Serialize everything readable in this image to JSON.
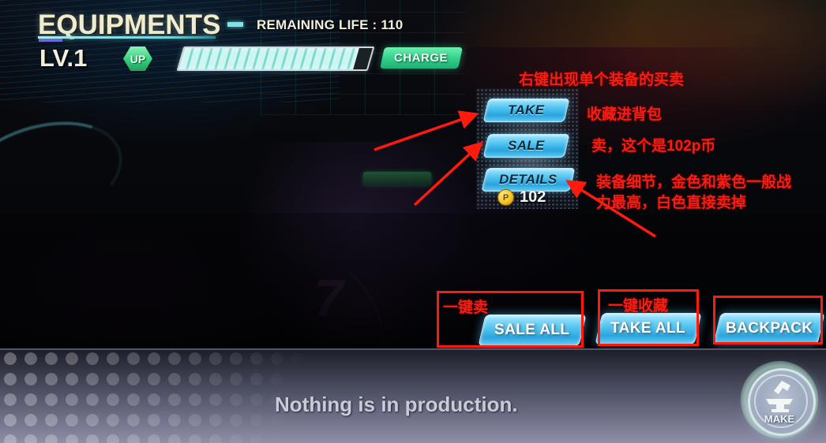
{
  "header": {
    "title": "EQUIPMENTS",
    "remaining_life": "REMAINING LIFE : 110",
    "level": "LV.1",
    "up_badge": "UP",
    "charge_label": "CHARGE",
    "xp_percent": 93
  },
  "context_menu": {
    "take": "TAKE",
    "sale": "SALE",
    "details": "DETAILS",
    "currency_symbol": "P",
    "price": "102"
  },
  "actions": {
    "sale_all": "SALE ALL",
    "take_all": "TAKE ALL",
    "backpack": "BACKPACK"
  },
  "status_bar": {
    "production_text": "Nothing is in production.",
    "make_label": "MAKE"
  },
  "annotations": [
    {
      "id": "right-click-hint",
      "text": "右键出现单个装备的买卖"
    },
    {
      "id": "take-hint",
      "text": "收藏进背包"
    },
    {
      "id": "sale-hint",
      "text": "卖，这个是102p币"
    },
    {
      "id": "details-hint",
      "text": "装备细节，金色和紫色一般战力最高，白色直接卖掉"
    },
    {
      "id": "sale-all-hint",
      "text": "一键卖"
    },
    {
      "id": "take-all-hint",
      "text": "一键收藏"
    }
  ],
  "colors": {
    "annotation_red": "#f61e12",
    "button_blue": "#4cc2ef",
    "charge_green": "#35cf8c",
    "title_cream": "#efeccf",
    "coin_gold": "#f5c425"
  }
}
